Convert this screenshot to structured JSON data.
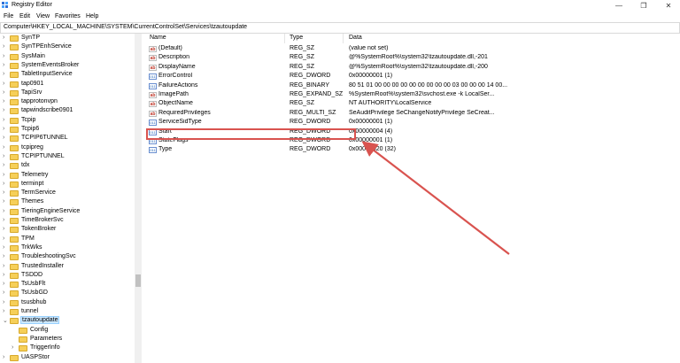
{
  "window": {
    "title": "Registry Editor",
    "min": "—",
    "restore": "❐",
    "close": "✕"
  },
  "menu": [
    "File",
    "Edit",
    "View",
    "Favorites",
    "Help"
  ],
  "address": "Computer\\HKEY_LOCAL_MACHINE\\SYSTEM\\CurrentControlSet\\Services\\tzautoupdate",
  "tree": [
    {
      "label": "SynTP",
      "chev": "›"
    },
    {
      "label": "SynTPEnhService",
      "chev": "›"
    },
    {
      "label": "SysMain",
      "chev": "›"
    },
    {
      "label": "SystemEventsBroker",
      "chev": "›"
    },
    {
      "label": "TabletInputService",
      "chev": "›"
    },
    {
      "label": "tap0901",
      "chev": "›"
    },
    {
      "label": "TapiSrv",
      "chev": "›"
    },
    {
      "label": "tapprotonvpn",
      "chev": "›"
    },
    {
      "label": "tapwindscribe0901",
      "chev": "›"
    },
    {
      "label": "Tcpip",
      "chev": "›"
    },
    {
      "label": "Tcpip6",
      "chev": "›"
    },
    {
      "label": "TCPIP6TUNNEL",
      "chev": "›"
    },
    {
      "label": "tcpipreg",
      "chev": "›"
    },
    {
      "label": "TCPIPTUNNEL",
      "chev": "›"
    },
    {
      "label": "tdx",
      "chev": "›"
    },
    {
      "label": "Telemetry",
      "chev": "›"
    },
    {
      "label": "terminpt",
      "chev": "›"
    },
    {
      "label": "TermService",
      "chev": "›"
    },
    {
      "label": "Themes",
      "chev": "›"
    },
    {
      "label": "TieringEngineService",
      "chev": "›"
    },
    {
      "label": "TimeBrokerSvc",
      "chev": "›"
    },
    {
      "label": "TokenBroker",
      "chev": "›"
    },
    {
      "label": "TPM",
      "chev": "›"
    },
    {
      "label": "TrkWks",
      "chev": "›"
    },
    {
      "label": "TroubleshootingSvc",
      "chev": "›"
    },
    {
      "label": "TrustedInstaller",
      "chev": "›"
    },
    {
      "label": "TSDDD",
      "chev": "›"
    },
    {
      "label": "TsUsbFlt",
      "chev": "›"
    },
    {
      "label": "TsUsbGD",
      "chev": "›"
    },
    {
      "label": "tsusbhub",
      "chev": "›"
    },
    {
      "label": "tunnel",
      "chev": "›"
    },
    {
      "label": "tzautoupdate",
      "chev": "⌄"
    },
    {
      "label": "Config",
      "chev": ""
    },
    {
      "label": "Parameters",
      "chev": ""
    },
    {
      "label": "TriggerInfo",
      "chev": "›"
    },
    {
      "label": "UASPStor",
      "chev": "›"
    }
  ],
  "columns": {
    "name": "Name",
    "type": "Type",
    "data": "Data"
  },
  "values": [
    {
      "icon": "ab",
      "name": "(Default)",
      "type": "REG_SZ",
      "data": "(value not set)"
    },
    {
      "icon": "ab",
      "name": "Description",
      "type": "REG_SZ",
      "data": "@%SystemRoot%\\system32\\tzautoupdate.dll,-201"
    },
    {
      "icon": "ab",
      "name": "DisplayName",
      "type": "REG_SZ",
      "data": "@%SystemRoot%\\system32\\tzautoupdate.dll,-200"
    },
    {
      "icon": "bin",
      "name": "ErrorControl",
      "type": "REG_DWORD",
      "data": "0x00000001 (1)"
    },
    {
      "icon": "bin",
      "name": "FailureActions",
      "type": "REG_BINARY",
      "data": "80 51 01 00 00 00 00 00 00 00 00 00 03 00 00 00 14 00..."
    },
    {
      "icon": "ab",
      "name": "ImagePath",
      "type": "REG_EXPAND_SZ",
      "data": "%SystemRoot%\\system32\\svchost.exe -k LocalSer..."
    },
    {
      "icon": "ab",
      "name": "ObjectName",
      "type": "REG_SZ",
      "data": "NT AUTHORITY\\LocalService"
    },
    {
      "icon": "ab",
      "name": "RequiredPrivileges",
      "type": "REG_MULTI_SZ",
      "data": "SeAuditPrivilege SeChangeNotifyPrivilege SeCreat..."
    },
    {
      "icon": "bin",
      "name": "ServiceSidType",
      "type": "REG_DWORD",
      "data": "0x00000001 (1)"
    },
    {
      "icon": "bin",
      "name": "Start",
      "type": "REG_DWORD",
      "data": "0x00000004 (4)"
    },
    {
      "icon": "bin",
      "name": "StateFlags",
      "type": "REG_DWORD",
      "data": "0x00000001 (1)"
    },
    {
      "icon": "bin",
      "name": "Type",
      "type": "REG_DWORD",
      "data": "0x00000020 (32)"
    }
  ],
  "annotation_color": "#d9534f"
}
